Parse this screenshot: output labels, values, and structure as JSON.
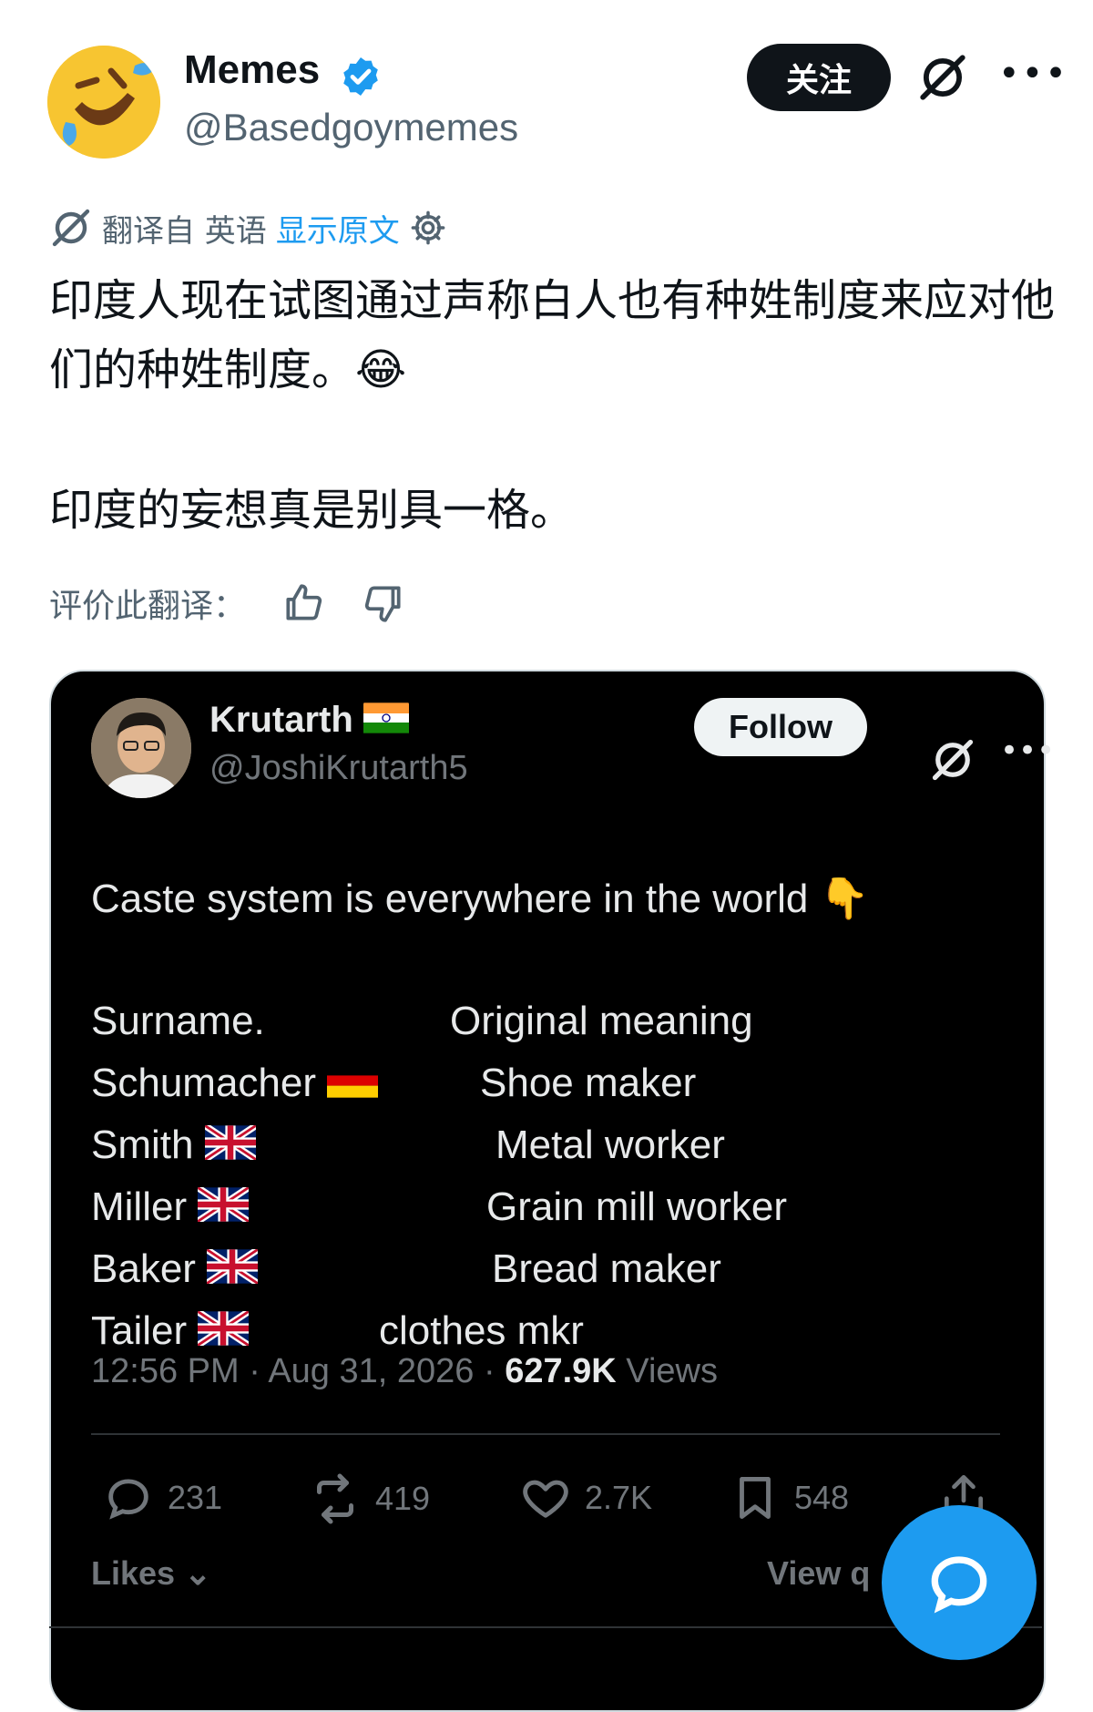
{
  "post": {
    "author_name": "Memes",
    "author_handle": "@Basedgoymemes",
    "follow_label": "关注",
    "translation": {
      "prefix": "翻译自 英语",
      "show_original": "显示原文"
    },
    "text_line1": "印度人现在试图通过声称白人也有种姓制度来应对他们的种姓制度。😂",
    "text_line2": "印度的妄想真是别具一格。",
    "rate_label": "评价此翻译："
  },
  "quoted": {
    "author_name": "Krutarth",
    "author_handle": "@JoshiKrutarth5",
    "follow_label": "Follow",
    "intro": "Caste system is everywhere in the world 👇",
    "header_surname": "Surname.",
    "header_meaning": "Original meaning",
    "rows": [
      {
        "surname": "Schumacher",
        "flag": "de",
        "meaning": "Shoe maker"
      },
      {
        "surname": "Smith",
        "flag": "uk",
        "meaning": "Metal worker"
      },
      {
        "surname": "Miller",
        "flag": "uk",
        "meaning": "Grain mill worker"
      },
      {
        "surname": "Baker",
        "flag": "uk",
        "meaning": "Bread maker"
      },
      {
        "surname": "Tailer",
        "flag": "uk",
        "meaning": "clothes mkr"
      }
    ],
    "time": "12:56 PM · Aug 31, 2026 · ",
    "views_count": "627.9K",
    "views_label": " Views",
    "replies": "231",
    "reposts": "419",
    "likes": "2.7K",
    "bookmarks": "548",
    "likes_label": "Likes",
    "view_quotes_label": "View q"
  },
  "colors": {
    "accent": "#1d9bf0",
    "card_bg": "#000000",
    "muted": "#536471"
  }
}
